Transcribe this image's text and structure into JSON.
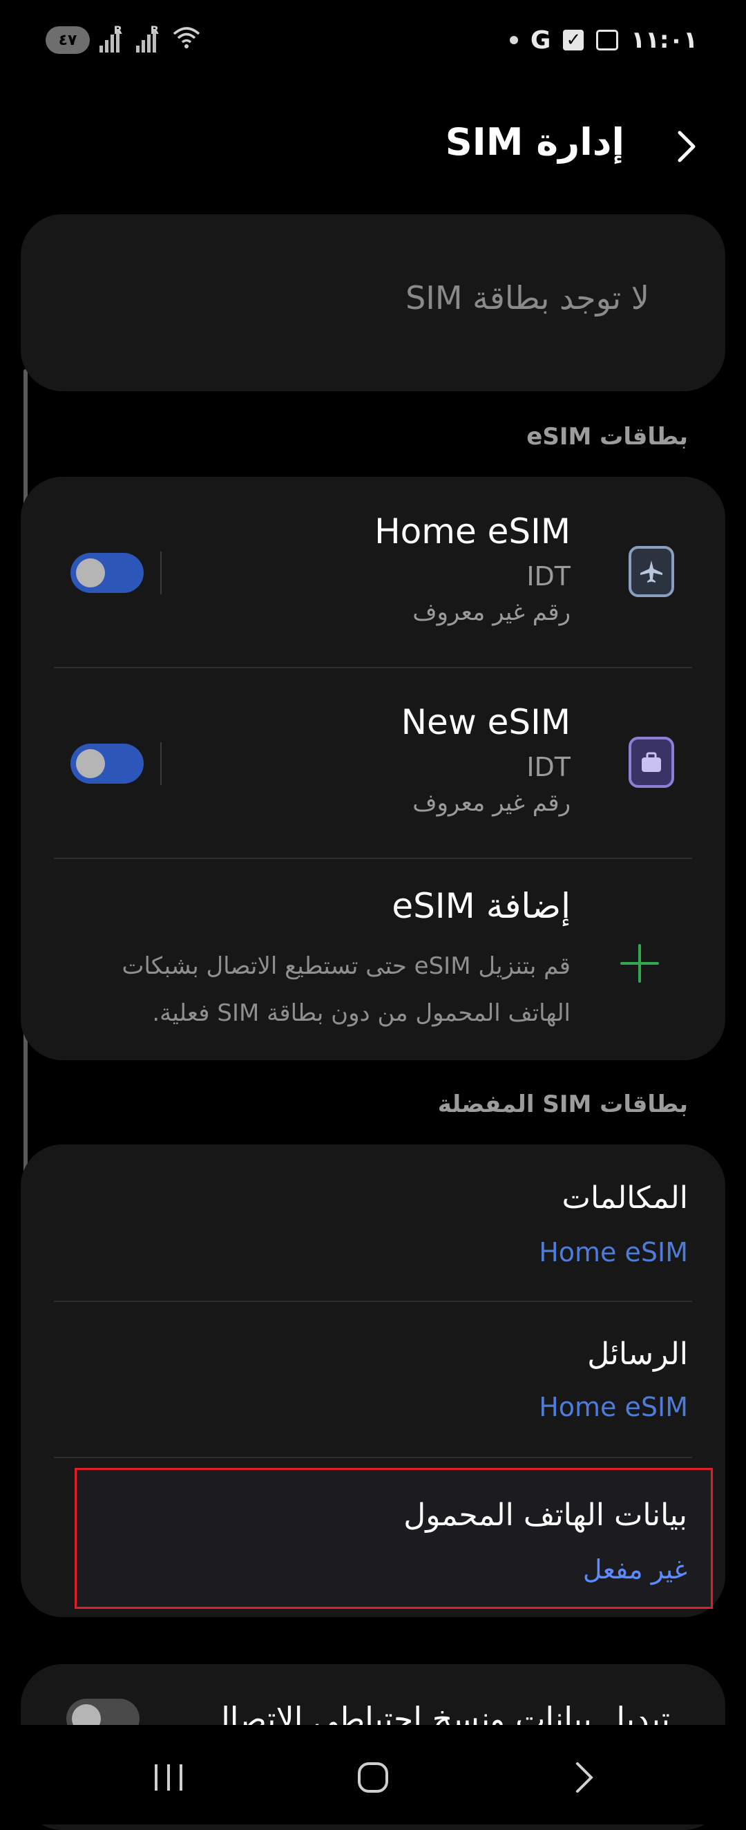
{
  "status_bar": {
    "battery": "٤٧",
    "roaming_mark": "R",
    "network": "G",
    "time": "١١:٠١"
  },
  "header": {
    "title": "إدارة SIM"
  },
  "no_sim": {
    "text": "لا توجد بطاقة SIM"
  },
  "esim_section": {
    "header": "بطاقات eSIM",
    "items": [
      {
        "name": "Home eSIM",
        "carrier": "IDT",
        "number": "رقم غير معروف",
        "icon": "airplane-icon",
        "color": "#8a9fbf",
        "enabled": true
      },
      {
        "name": "New eSIM",
        "carrier": "IDT",
        "number": "رقم غير معروف",
        "icon": "briefcase-icon",
        "color": "#8c7fd6",
        "enabled": true
      }
    ],
    "add": {
      "title": "إضافة eSIM",
      "description": "قم بتنزيل eSIM حتى تستطيع الاتصال بشبكات الهاتف المحمول من دون بطاقة SIM فعلية."
    }
  },
  "preferred_section": {
    "header": "بطاقات SIM المفضلة",
    "items": [
      {
        "label": "المكالمات",
        "value": "Home eSIM"
      },
      {
        "label": "الرسائل",
        "value": "Home eSIM"
      },
      {
        "label": "بيانات الهاتف المحمول",
        "value": "غير مفعل"
      }
    ]
  },
  "bottom_item": {
    "label": "تبديل بيانات ونسخ احتياطي الاتصال"
  },
  "colors": {
    "accent": "#4f7bd9",
    "toggle_on": "#2c56b8",
    "plus": "#2fa84f",
    "highlight": "#e01e2a"
  }
}
